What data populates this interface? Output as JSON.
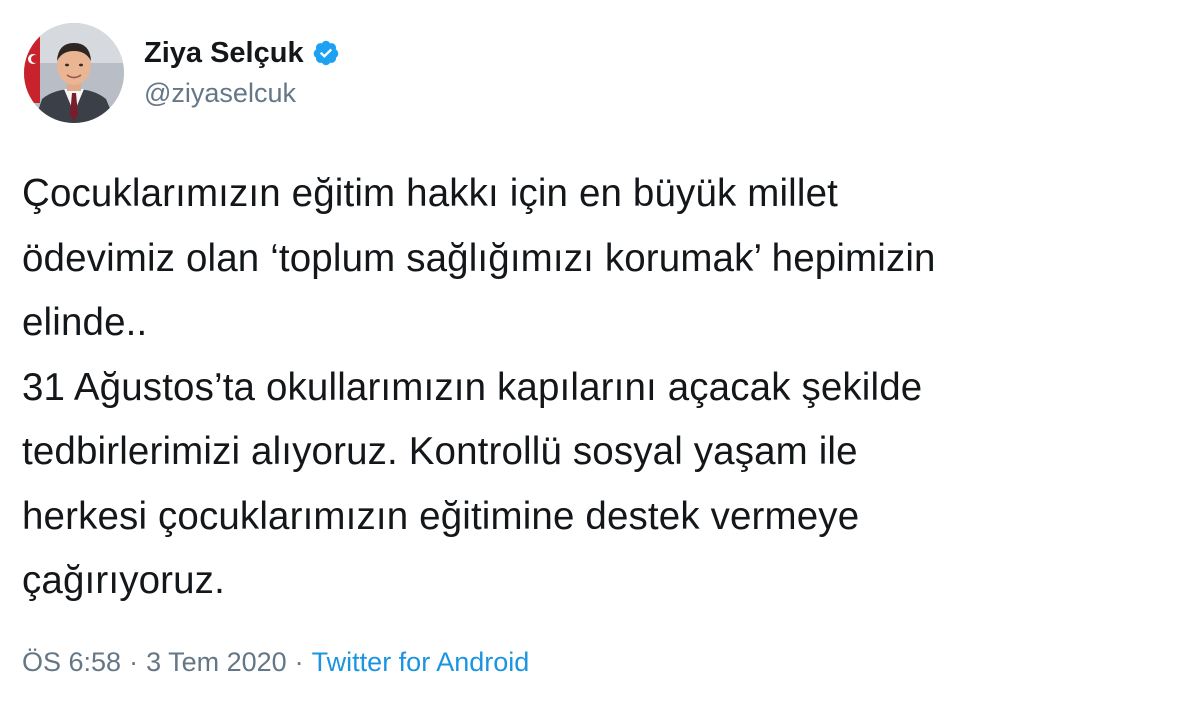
{
  "author": {
    "display_name": "Ziya Selçuk",
    "handle": "@ziyaselcuk",
    "verified": true
  },
  "tweet": {
    "text": "Çocuklarımızın eğitim hakkı için en büyük millet\nödevimiz olan ‘toplum sağlığımızı korumak’ hepimizin\nelinde..\n31 Ağustos’ta okullarımızın kapılarını açacak şekilde\ntedbirlerimizi alıyoruz.  Kontrollü sosyal yaşam ile\nherkesi çocuklarımızın eğitimine destek vermeye\nçağırıyoruz."
  },
  "meta": {
    "time": "ÖS 6:58",
    "separator": "·",
    "date": "3 Tem 2020",
    "source": "Twitter for Android"
  },
  "colors": {
    "text": "#14171a",
    "secondary": "#657786",
    "link": "#1b95e0",
    "verified_badge": "#1da1f2"
  },
  "icons": {
    "verified": "verified-badge-icon",
    "avatar": "profile-photo"
  }
}
